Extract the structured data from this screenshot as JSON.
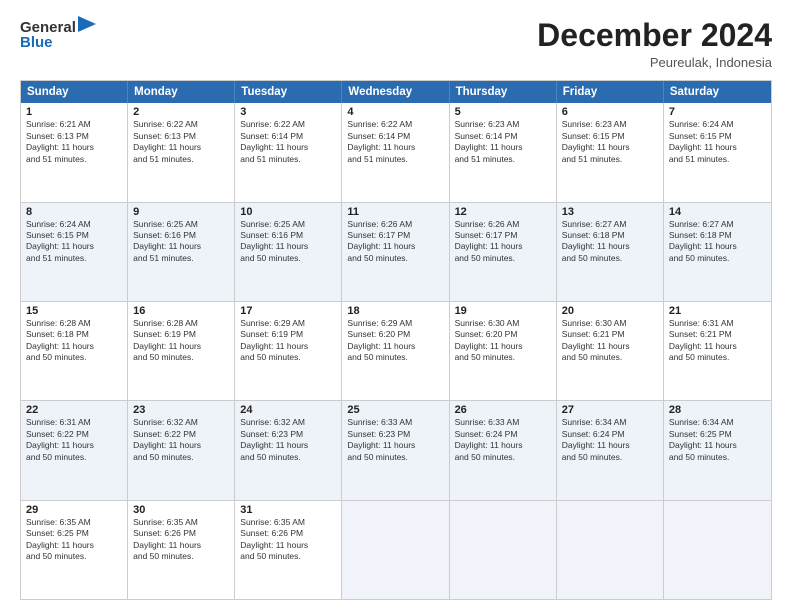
{
  "header": {
    "logo": {
      "line1": "General",
      "line2": "Blue"
    },
    "month_year": "December 2024",
    "location": "Peureulak, Indonesia"
  },
  "weekdays": [
    "Sunday",
    "Monday",
    "Tuesday",
    "Wednesday",
    "Thursday",
    "Friday",
    "Saturday"
  ],
  "rows": [
    [
      {
        "day": "1",
        "info": "Sunrise: 6:21 AM\nSunset: 6:13 PM\nDaylight: 11 hours\nand 51 minutes."
      },
      {
        "day": "2",
        "info": "Sunrise: 6:22 AM\nSunset: 6:13 PM\nDaylight: 11 hours\nand 51 minutes."
      },
      {
        "day": "3",
        "info": "Sunrise: 6:22 AM\nSunset: 6:14 PM\nDaylight: 11 hours\nand 51 minutes."
      },
      {
        "day": "4",
        "info": "Sunrise: 6:22 AM\nSunset: 6:14 PM\nDaylight: 11 hours\nand 51 minutes."
      },
      {
        "day": "5",
        "info": "Sunrise: 6:23 AM\nSunset: 6:14 PM\nDaylight: 11 hours\nand 51 minutes."
      },
      {
        "day": "6",
        "info": "Sunrise: 6:23 AM\nSunset: 6:15 PM\nDaylight: 11 hours\nand 51 minutes."
      },
      {
        "day": "7",
        "info": "Sunrise: 6:24 AM\nSunset: 6:15 PM\nDaylight: 11 hours\nand 51 minutes."
      }
    ],
    [
      {
        "day": "8",
        "info": "Sunrise: 6:24 AM\nSunset: 6:15 PM\nDaylight: 11 hours\nand 51 minutes."
      },
      {
        "day": "9",
        "info": "Sunrise: 6:25 AM\nSunset: 6:16 PM\nDaylight: 11 hours\nand 51 minutes."
      },
      {
        "day": "10",
        "info": "Sunrise: 6:25 AM\nSunset: 6:16 PM\nDaylight: 11 hours\nand 50 minutes."
      },
      {
        "day": "11",
        "info": "Sunrise: 6:26 AM\nSunset: 6:17 PM\nDaylight: 11 hours\nand 50 minutes."
      },
      {
        "day": "12",
        "info": "Sunrise: 6:26 AM\nSunset: 6:17 PM\nDaylight: 11 hours\nand 50 minutes."
      },
      {
        "day": "13",
        "info": "Sunrise: 6:27 AM\nSunset: 6:18 PM\nDaylight: 11 hours\nand 50 minutes."
      },
      {
        "day": "14",
        "info": "Sunrise: 6:27 AM\nSunset: 6:18 PM\nDaylight: 11 hours\nand 50 minutes."
      }
    ],
    [
      {
        "day": "15",
        "info": "Sunrise: 6:28 AM\nSunset: 6:18 PM\nDaylight: 11 hours\nand 50 minutes."
      },
      {
        "day": "16",
        "info": "Sunrise: 6:28 AM\nSunset: 6:19 PM\nDaylight: 11 hours\nand 50 minutes."
      },
      {
        "day": "17",
        "info": "Sunrise: 6:29 AM\nSunset: 6:19 PM\nDaylight: 11 hours\nand 50 minutes."
      },
      {
        "day": "18",
        "info": "Sunrise: 6:29 AM\nSunset: 6:20 PM\nDaylight: 11 hours\nand 50 minutes."
      },
      {
        "day": "19",
        "info": "Sunrise: 6:30 AM\nSunset: 6:20 PM\nDaylight: 11 hours\nand 50 minutes."
      },
      {
        "day": "20",
        "info": "Sunrise: 6:30 AM\nSunset: 6:21 PM\nDaylight: 11 hours\nand 50 minutes."
      },
      {
        "day": "21",
        "info": "Sunrise: 6:31 AM\nSunset: 6:21 PM\nDaylight: 11 hours\nand 50 minutes."
      }
    ],
    [
      {
        "day": "22",
        "info": "Sunrise: 6:31 AM\nSunset: 6:22 PM\nDaylight: 11 hours\nand 50 minutes."
      },
      {
        "day": "23",
        "info": "Sunrise: 6:32 AM\nSunset: 6:22 PM\nDaylight: 11 hours\nand 50 minutes."
      },
      {
        "day": "24",
        "info": "Sunrise: 6:32 AM\nSunset: 6:23 PM\nDaylight: 11 hours\nand 50 minutes."
      },
      {
        "day": "25",
        "info": "Sunrise: 6:33 AM\nSunset: 6:23 PM\nDaylight: 11 hours\nand 50 minutes."
      },
      {
        "day": "26",
        "info": "Sunrise: 6:33 AM\nSunset: 6:24 PM\nDaylight: 11 hours\nand 50 minutes."
      },
      {
        "day": "27",
        "info": "Sunrise: 6:34 AM\nSunset: 6:24 PM\nDaylight: 11 hours\nand 50 minutes."
      },
      {
        "day": "28",
        "info": "Sunrise: 6:34 AM\nSunset: 6:25 PM\nDaylight: 11 hours\nand 50 minutes."
      }
    ],
    [
      {
        "day": "29",
        "info": "Sunrise: 6:35 AM\nSunset: 6:25 PM\nDaylight: 11 hours\nand 50 minutes."
      },
      {
        "day": "30",
        "info": "Sunrise: 6:35 AM\nSunset: 6:26 PM\nDaylight: 11 hours\nand 50 minutes."
      },
      {
        "day": "31",
        "info": "Sunrise: 6:35 AM\nSunset: 6:26 PM\nDaylight: 11 hours\nand 50 minutes."
      },
      null,
      null,
      null,
      null
    ]
  ]
}
